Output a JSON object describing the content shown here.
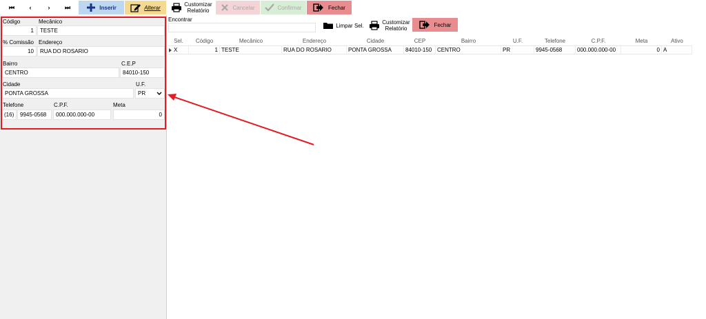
{
  "toolbar": {
    "nav": [
      "⏮",
      "‹",
      "›",
      "⏭"
    ],
    "inserir": "Inserir",
    "alterar": "Alterar",
    "customizar_line1": "Customizar",
    "customizar_line2": "Relatório",
    "cancelar": "Cancelar",
    "confirmar": "Confirmar",
    "fechar": "Fechar"
  },
  "form": {
    "codigo_label": "Código",
    "codigo_value": "1",
    "mecanico_label": "Mecânico",
    "mecanico_value": "TESTE",
    "comissao_label": "% Comissão",
    "comissao_value": "10",
    "endereco_label": "Endereço",
    "endereco_value": "RUA DO ROSARIO",
    "bairro_label": "Bairro",
    "bairro_value": "CENTRO",
    "cep_label": "C.E.P",
    "cep_value": "84010-150",
    "cidade_label": "Cidade",
    "cidade_value": "PONTA GROSSA",
    "uf_label": "U.F.",
    "uf_value": "PR",
    "telefone_label": "Telefone",
    "ddd_value": "(16)",
    "telefone_value": "9945-0568",
    "cpf_label": "C.P.F.",
    "cpf_value": "000.000.000-00",
    "meta_label": "Meta",
    "meta_value": "0"
  },
  "search": {
    "encontrar_label": "Encontrar",
    "encontrar_value": "",
    "limpar_label": "Limpar Sel.",
    "customizar_line1": "Customizar",
    "customizar_line2": "Relatório",
    "fechar": "Fechar"
  },
  "grid": {
    "columns": [
      "Sel.",
      "Código",
      "Mecânico",
      "Endereço",
      "Cidade",
      "CEP",
      "Bairro",
      "U.F.",
      "Telefone",
      "C.P.F.",
      "Meta",
      "Ativo"
    ],
    "rows": [
      {
        "sel": "X",
        "codigo": "1",
        "mecanico": "TESTE",
        "endereco": "RUA DO ROSARIO",
        "cidade": "PONTA GROSSA",
        "cep": "84010-150",
        "bairro": "CENTRO",
        "uf": "PR",
        "telefone": "9945-0568",
        "cpf": "000.000.000-00",
        "meta": "0",
        "ativo": "A"
      }
    ]
  },
  "colors": {
    "inserir_bg": "#bcd7ee",
    "alterar_bg": "#f3d992",
    "cancelar_bg": "#f4d5d7",
    "confirmar_bg": "#d8edd5",
    "fechar_bg": "#e98c90",
    "highlight": "#e31b23"
  }
}
